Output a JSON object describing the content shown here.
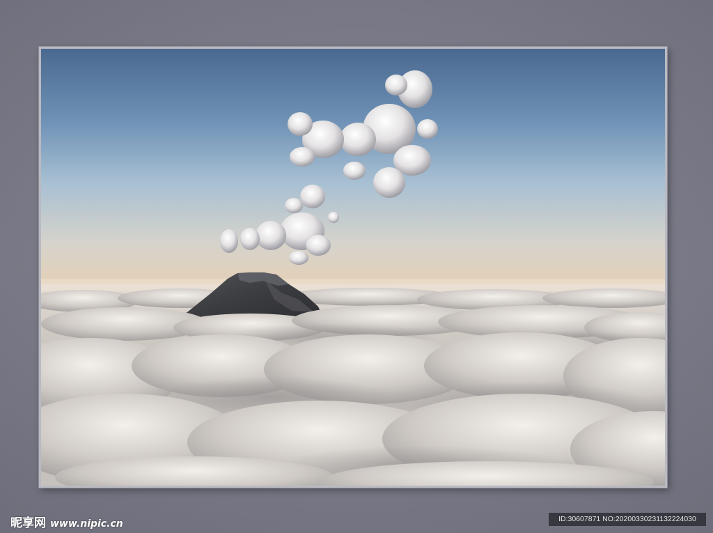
{
  "watermark": {
    "site_name": "昵享网",
    "site_url": "www.nipic.cn"
  },
  "image_id": {
    "text": "ID:30607871 NO:20200330231132224030"
  },
  "colors": {
    "wall": "#7d7d8c",
    "frame_border": "#b9bac2",
    "sky_top": "#4d6d93",
    "sky_mid": "#8fb0ce",
    "horizon": "#dcc9b3",
    "cloud": "#d9d4cf",
    "mountain": "#3e3e42"
  },
  "icons": {
    "photo": "mountain-above-clouds-photo"
  }
}
